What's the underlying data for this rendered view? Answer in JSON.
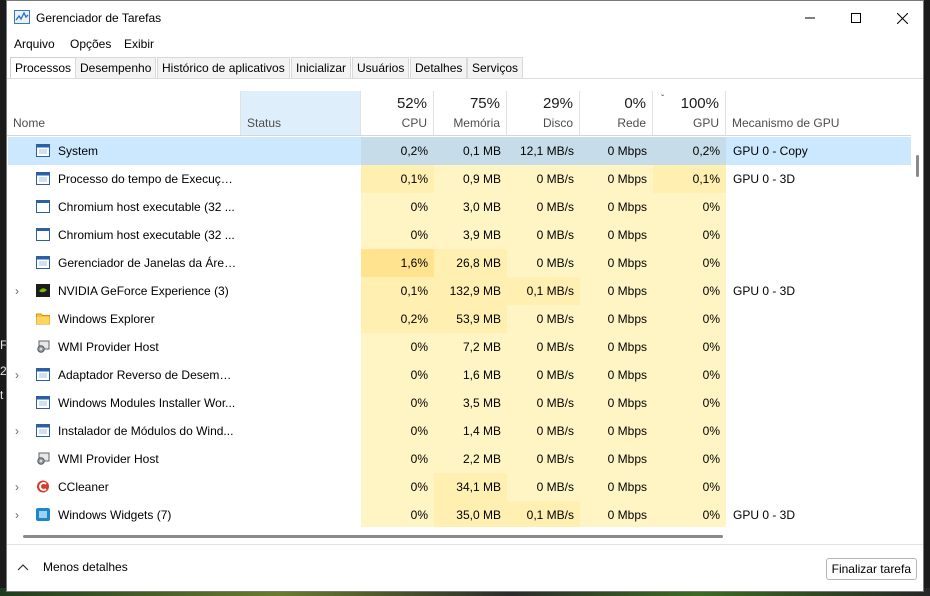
{
  "window": {
    "title": "Gerenciador de Tarefas",
    "controls": {
      "minimize": "—",
      "maximize": "☐",
      "close": "✕"
    }
  },
  "background_text": [
    "F",
    "2",
    "t"
  ],
  "menu": [
    "Arquivo",
    "Opções",
    "Exibir"
  ],
  "tabs": [
    "Processos",
    "Desempenho",
    "Histórico de aplicativos",
    "Inicializar",
    "Usuários",
    "Detalhes",
    "Serviços"
  ],
  "active_tab": "Processos",
  "columns": {
    "name": "Nome",
    "status": "Status",
    "cpu": {
      "pct": "52%",
      "label": "CPU"
    },
    "memory": {
      "pct": "75%",
      "label": "Memória"
    },
    "disk": {
      "pct": "29%",
      "label": "Disco"
    },
    "network": {
      "pct": "0%",
      "label": "Rede"
    },
    "gpu": {
      "pct": "100%",
      "label": "GPU",
      "sort_indicator": "ˇ"
    },
    "gpu_engine": "Mecanismo de GPU"
  },
  "processes": [
    {
      "name": "System",
      "icon": "system-window-icon",
      "expand": "",
      "cpu": "0,2%",
      "memory": "0,1 MB",
      "disk": "12,1 MB/s",
      "network": "0 Mbps",
      "gpu": "0,2%",
      "gpu_engine": "GPU 0 - Copy",
      "selected": true
    },
    {
      "name": "Processo do tempo de Execução...",
      "icon": "system-window-icon",
      "expand": "",
      "cpu": "0,1%",
      "memory": "0,9 MB",
      "disk": "0 MB/s",
      "network": "0 Mbps",
      "gpu": "0,1%",
      "gpu_engine": "GPU 0 - 3D"
    },
    {
      "name": "Chromium host executable (32 ...",
      "icon": "app-window-icon",
      "expand": "",
      "cpu": "0%",
      "memory": "3,0 MB",
      "disk": "0 MB/s",
      "network": "0 Mbps",
      "gpu": "0%",
      "gpu_engine": ""
    },
    {
      "name": "Chromium host executable (32 ...",
      "icon": "app-window-icon",
      "expand": "",
      "cpu": "0%",
      "memory": "3,9 MB",
      "disk": "0 MB/s",
      "network": "0 Mbps",
      "gpu": "0%",
      "gpu_engine": ""
    },
    {
      "name": "Gerenciador de Janelas da Área ...",
      "icon": "system-window-icon",
      "expand": "",
      "cpu": "1,6%",
      "memory": "26,8 MB",
      "disk": "0 MB/s",
      "network": "0 Mbps",
      "gpu": "0%",
      "gpu_engine": ""
    },
    {
      "name": "NVIDIA GeForce Experience (3)",
      "icon": "nvidia-icon",
      "expand": "›",
      "cpu": "0,1%",
      "memory": "132,9 MB",
      "disk": "0,1 MB/s",
      "network": "0 Mbps",
      "gpu": "0%",
      "gpu_engine": "GPU 0 - 3D"
    },
    {
      "name": "Windows Explorer",
      "icon": "folder-icon",
      "expand": "",
      "cpu": "0,2%",
      "memory": "53,9 MB",
      "disk": "0 MB/s",
      "network": "0 Mbps",
      "gpu": "0%",
      "gpu_engine": ""
    },
    {
      "name": "WMI Provider Host",
      "icon": "service-host-icon",
      "expand": "",
      "cpu": "0%",
      "memory": "7,2 MB",
      "disk": "0 MB/s",
      "network": "0 Mbps",
      "gpu": "0%",
      "gpu_engine": ""
    },
    {
      "name": "Adaptador Reverso de Desempe...",
      "icon": "system-window-icon",
      "expand": "›",
      "cpu": "0%",
      "memory": "1,6 MB",
      "disk": "0 MB/s",
      "network": "0 Mbps",
      "gpu": "0%",
      "gpu_engine": ""
    },
    {
      "name": "Windows Modules Installer Wor...",
      "icon": "system-window-icon",
      "expand": "",
      "cpu": "0%",
      "memory": "3,5 MB",
      "disk": "0 MB/s",
      "network": "0 Mbps",
      "gpu": "0%",
      "gpu_engine": ""
    },
    {
      "name": "Instalador de Módulos do Wind...",
      "icon": "system-window-icon",
      "expand": "›",
      "cpu": "0%",
      "memory": "1,4 MB",
      "disk": "0 MB/s",
      "network": "0 Mbps",
      "gpu": "0%",
      "gpu_engine": ""
    },
    {
      "name": "WMI Provider Host",
      "icon": "service-host-icon",
      "expand": "",
      "cpu": "0%",
      "memory": "2,2 MB",
      "disk": "0 MB/s",
      "network": "0 Mbps",
      "gpu": "0%",
      "gpu_engine": ""
    },
    {
      "name": "CCleaner",
      "icon": "ccleaner-icon",
      "expand": "›",
      "cpu": "0%",
      "memory": "34,1 MB",
      "disk": "0 MB/s",
      "network": "0 Mbps",
      "gpu": "0%",
      "gpu_engine": ""
    },
    {
      "name": "Windows Widgets (7)",
      "icon": "widgets-icon",
      "expand": "›",
      "cpu": "0%",
      "memory": "35,0 MB",
      "disk": "0,1 MB/s",
      "network": "0 Mbps",
      "gpu": "0%",
      "gpu_engine": "GPU 0 - 3D"
    }
  ],
  "footer": {
    "less_details": "Menos detalhes",
    "end_task": "Finalizar tarefa"
  },
  "colors": {
    "heat_light": "#fff4c4",
    "heat_medium": "#ffefb0",
    "heat_strong": "#ffe38f",
    "selection": "#cce8ff",
    "status_header": "#dfeefb"
  }
}
